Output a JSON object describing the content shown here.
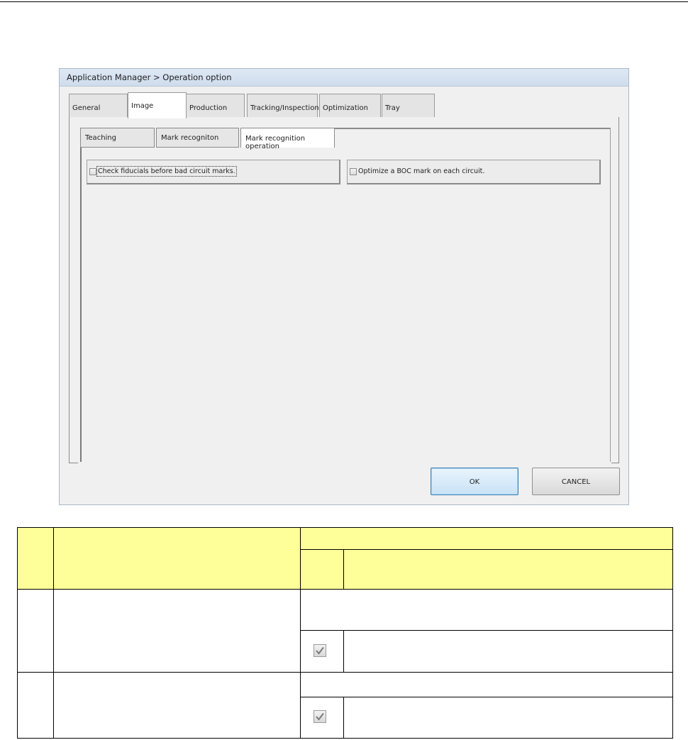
{
  "dialog": {
    "title": "Application Manager > Operation option",
    "tabs": [
      {
        "label": "General",
        "active": false
      },
      {
        "label": "Image",
        "active": true
      },
      {
        "label": "Production",
        "active": false
      },
      {
        "label": "Tracking/Inspection",
        "active": false
      },
      {
        "label": "Optimization",
        "active": false
      },
      {
        "label": "Tray",
        "active": false
      }
    ],
    "subtabs": [
      {
        "label": "Teaching",
        "active": false
      },
      {
        "label": "Mark recogniton",
        "active": false
      },
      {
        "label": "Mark recognition operation",
        "active": true
      }
    ],
    "options": [
      {
        "label": "Check fiducials before bad circuit marks.",
        "checked": false
      },
      {
        "label": "Optimize a BOC mark on each circuit.",
        "checked": false
      }
    ],
    "buttons": {
      "ok": "OK",
      "cancel": "CANCEL"
    }
  },
  "doc_table": {
    "rows": [
      {
        "check_icon": "checkmark-icon"
      },
      {
        "check_icon": "checkmark-icon"
      }
    ]
  },
  "colors": {
    "header_fill": "#ffff99",
    "ok_border": "#3c7fb1"
  }
}
